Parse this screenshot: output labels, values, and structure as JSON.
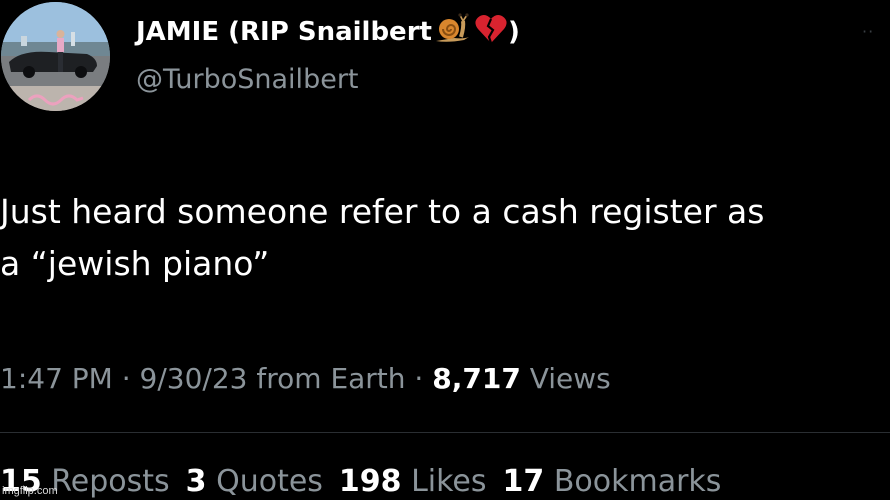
{
  "author": {
    "display_name": "JAMIE (RIP Snailbert",
    "name_suffix": " )",
    "emoji_icons": [
      "snail-emoji",
      "broken-heart-emoji"
    ],
    "handle": "@TurboSnailbert",
    "avatar_caption": "Snailbert"
  },
  "more_menu": "··",
  "tweet": {
    "lines": [
      "Just heard someone refer to a cash register as",
      "a “jewish piano”"
    ]
  },
  "meta": {
    "time": "1:47 PM",
    "sep1": " · ",
    "date": "9/30/23",
    "source": " from Earth",
    "sep2": " · ",
    "views_count": "8,717",
    "views_label": " Views"
  },
  "stats": {
    "reposts_count": "15",
    "reposts_label": " Reposts",
    "quotes_count": "3",
    "quotes_label": " Quotes",
    "likes_count": "198",
    "likes_label": " Likes",
    "bookmarks_count": "17",
    "bookmarks_label": " Bookmarks"
  },
  "watermark": "imgflip.com",
  "colors": {
    "background": "#000000",
    "primary_text": "#ffffff",
    "secondary_text": "#8b949a",
    "divider": "#2a2e32"
  }
}
